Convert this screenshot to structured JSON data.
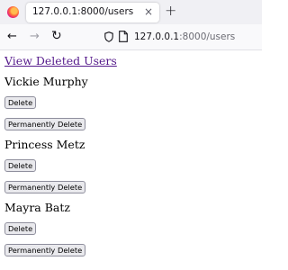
{
  "browser": {
    "tab_title": "127.0.0.1:8000/users",
    "tab_close": "×",
    "new_tab": "+",
    "nav": {
      "back": "←",
      "forward": "→",
      "reload": "↻"
    },
    "url_host": "127.0.0.1",
    "url_rest": ":8000/users"
  },
  "page": {
    "view_deleted_link": "View Deleted Users",
    "users": [
      {
        "name": "Vickie Murphy",
        "delete_label": "Delete",
        "perm_delete_label": "Permanently Delete"
      },
      {
        "name": "Princess Metz",
        "delete_label": "Delete",
        "perm_delete_label": "Permanently Delete"
      },
      {
        "name": "Mayra Batz",
        "delete_label": "Delete",
        "perm_delete_label": "Permanently Delete"
      }
    ]
  },
  "colors": {
    "link": "#551a8b",
    "button_bg": "#e9e9ed"
  }
}
